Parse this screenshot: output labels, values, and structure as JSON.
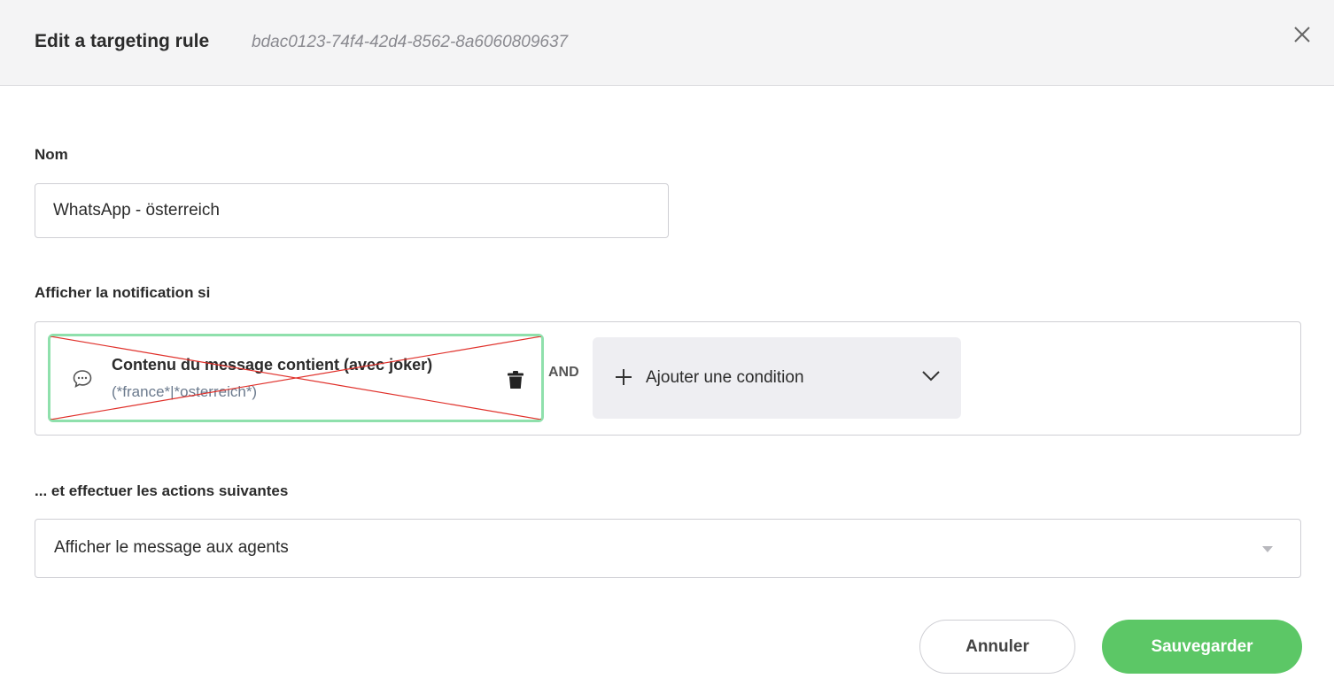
{
  "header": {
    "title": "Edit a targeting rule",
    "rule_id": "bdac0123-74f4-42d4-8562-8a6060809637"
  },
  "name_field": {
    "label": "Nom",
    "value": "WhatsApp - österreich"
  },
  "conditions": {
    "label": "Afficher la notification si",
    "items": [
      {
        "title": "Contenu du message contient (avec joker)",
        "value": "(*france*|*osterreich*)"
      }
    ],
    "operator": "AND",
    "add_label": "Ajouter une condition"
  },
  "actions": {
    "label": "... et effectuer les actions suivantes",
    "selected": "Afficher le message aux agents"
  },
  "footer": {
    "cancel_label": "Annuler",
    "save_label": "Sauvegarder"
  },
  "colors": {
    "save_button": "#5cc766",
    "condition_border": "#8fe0ac",
    "cross_out": "#e0302a"
  }
}
